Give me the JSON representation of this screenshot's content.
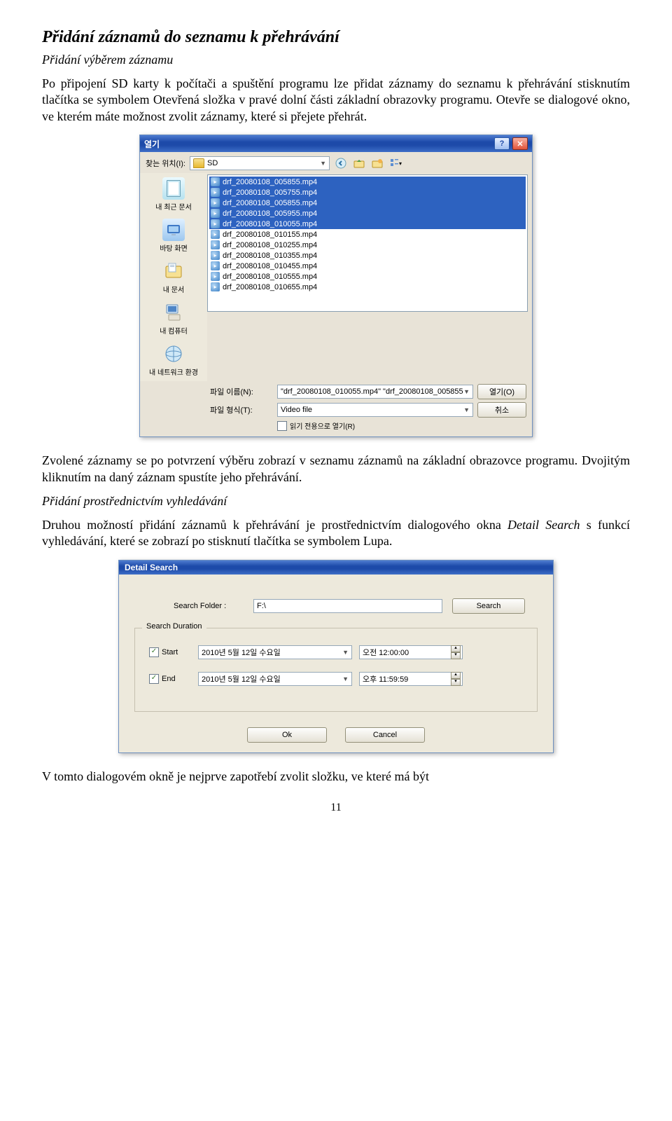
{
  "h2": "Přidání záznamů do seznamu k přehrávání",
  "sub1": "Přidání výběrem záznamu",
  "p1": "Po připojení SD karty k počítači a spuštění programu lze přidat záznamy do seznamu k přehrávání stisknutím tlačítka se symbolem Otevřená složka v pravé dolní části základní obrazovky programu. Otevře se dialogové okno, ve kterém máte možnost zvolit záznamy, které si přejete přehrát.",
  "p2": "Zvolené záznamy se po potvrzení výběru zobrazí v seznamu záznamů na základní obrazovce programu. Dvojitým kliknutím na daný záznam spustíte jeho přehrávání.",
  "sub2": "Přidání prostřednictvím vyhledávání",
  "p3": "Druhou možností přidání záznamů k přehrávání je prostřednictvím dialogového okna Detail Search s funkcí vyhledávání, které se zobrazí po stisknutí tlačítka se symbolem Lupa.",
  "p4": "V tomto dialogovém okně je nejprve zapotřebí zvolit složku, ve které má být",
  "page": "11",
  "dlg1": {
    "title": "열기",
    "lookin_label": "찾는 위치(I):",
    "folder": "SD",
    "sidebar": [
      "내 최근 문서",
      "바탕 화면",
      "내 문서",
      "내 컴퓨터",
      "내 네트워크 환경"
    ],
    "files_sel": [
      "drf_20080108_005855.mp4",
      "drf_20080108_005755.mp4",
      "drf_20080108_005855.mp4",
      "drf_20080108_005955.mp4",
      "drf_20080108_010055.mp4"
    ],
    "files": [
      "drf_20080108_010155.mp4",
      "drf_20080108_010255.mp4",
      "drf_20080108_010355.mp4",
      "drf_20080108_010455.mp4",
      "drf_20080108_010555.mp4",
      "drf_20080108_010655.mp4"
    ],
    "filename_label": "파일 이름(N):",
    "filename_value": "\"drf_20080108_010055.mp4\" \"drf_20080108_005855",
    "filetype_label": "파일 형식(T):",
    "filetype_value": "Video file",
    "open_btn": "열기(O)",
    "cancel_btn": "취소",
    "readonly": "읽기 전용으로 열기(R)"
  },
  "dlg2": {
    "title": "Detail Search",
    "folder_label": "Search Folder :",
    "folder_value": "F:\\",
    "search_btn": "Search",
    "legend": "Search Duration",
    "start_label": "Start",
    "start_date": "2010년  5월 12일 수요일",
    "start_time": "오전 12:00:00",
    "end_label": "End",
    "end_date": "2010년  5월 12일 수요일",
    "end_time": "오후 11:59:59",
    "ok": "Ok",
    "cancel": "Cancel"
  }
}
